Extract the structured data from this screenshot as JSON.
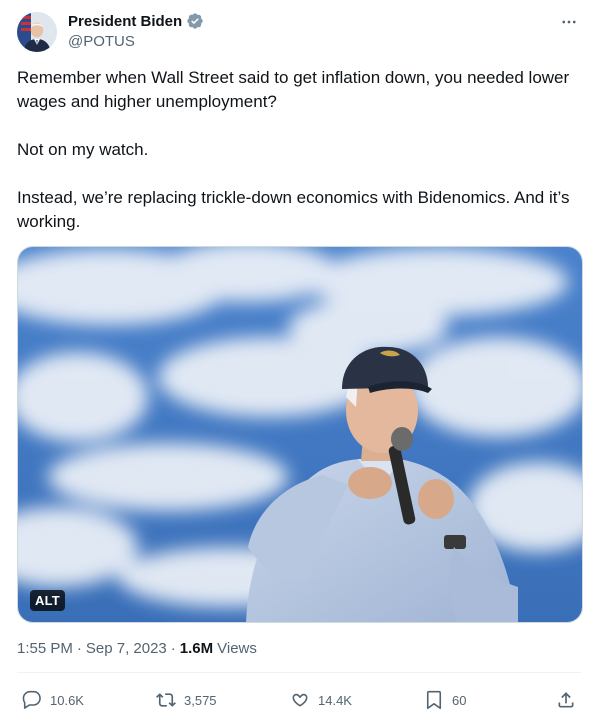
{
  "author": {
    "name": "President Biden",
    "handle": "@POTUS",
    "avatar_icon": "biden-portrait-avatar",
    "verified_icon": "verified-badge-icon",
    "verified_color": "#829aab"
  },
  "menu": {
    "icon": "more-options-icon"
  },
  "tweet": {
    "paragraphs": [
      "Remember when Wall Street said to get inflation down, you needed lower wages and higher unemployment?",
      "Not on my watch.",
      "Instead, we’re replacing trickle-down economics with Bidenomics. And it’s working."
    ]
  },
  "media": {
    "alt_label": "ALT",
    "sky_color": "#3f78c4",
    "cloud_color": "#eef2f8"
  },
  "meta": {
    "time": "1:55 PM",
    "date": "Sep 7, 2023",
    "separator": "·",
    "views_count": "1.6M",
    "views_label": "Views"
  },
  "actions": {
    "replies": "10.6K",
    "reposts": "3,575",
    "likes": "14.4K",
    "bookmarks": "60",
    "icons": [
      "reply-icon",
      "repost-icon",
      "like-icon",
      "bookmark-icon",
      "share-icon"
    ],
    "icon_color": "#536471"
  }
}
